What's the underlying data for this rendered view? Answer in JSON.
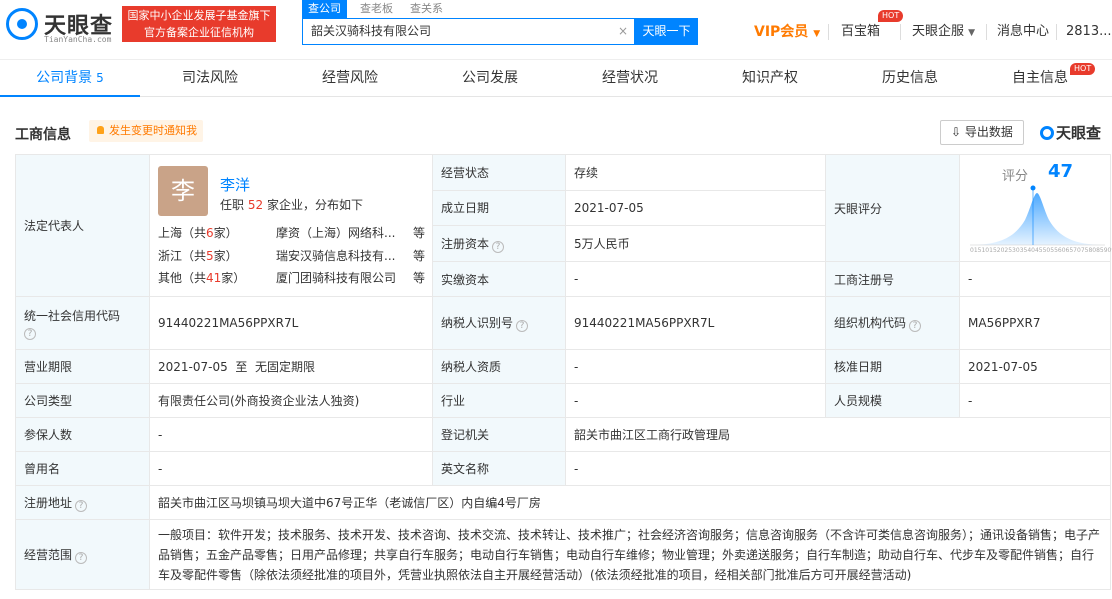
{
  "header": {
    "logo_name": "天眼查",
    "logo_sub": "TianYanCha.com",
    "fund_line1": "国家中小企业发展子基金旗下",
    "fund_line2": "官方备案企业征信机构",
    "search_tabs": [
      "查公司",
      "查老板",
      "查关系"
    ],
    "search_value": "韶关汉骑科技有限公司",
    "search_button": "天眼一下",
    "vip": "VIP会员",
    "baibaoxiang": "百宝箱",
    "hot": "HOT",
    "qiye": "天眼企服",
    "msg": "消息中心",
    "user": "2813..."
  },
  "tabs": [
    {
      "label": "公司背景",
      "count": "5"
    },
    {
      "label": "司法风险"
    },
    {
      "label": "经营风险"
    },
    {
      "label": "公司发展"
    },
    {
      "label": "经营状况"
    },
    {
      "label": "知识产权"
    },
    {
      "label": "历史信息"
    },
    {
      "label": "自主信息"
    }
  ],
  "section": {
    "title": "工商信息",
    "notify": "发生变更时通知我",
    "export": "导出数据",
    "brand": "天眼查"
  },
  "rep": {
    "label": "法定代表人",
    "avatar": "李",
    "name": "李洋",
    "sub_pre": "任职",
    "sub_num": "52",
    "sub_post": "家企业，分布如下",
    "rows": [
      {
        "region": "上海（共",
        "num": "6",
        "post": "家）",
        "company": "摩资（上海）网络科...",
        "more": "等"
      },
      {
        "region": "浙江（共",
        "num": "5",
        "post": "家）",
        "company": "瑞安汉骑信息科技有...",
        "more": "等"
      },
      {
        "region": "其他（共",
        "num": "41",
        "post": "家）",
        "company": "厦门团骑科技有限公司",
        "more": "等"
      }
    ]
  },
  "fields": {
    "status_l": "经营状态",
    "status_v": "存续",
    "found_l": "成立日期",
    "found_v": "2021-07-05",
    "capital_l": "注册资本",
    "capital_v": "5万人民币",
    "paid_l": "实缴资本",
    "paid_v": "-",
    "score_l": "天眼评分",
    "score_lab": "评分",
    "score_val": "47",
    "score_scale": [
      "0",
      "1",
      "5",
      "10",
      "15",
      "20",
      "25",
      "30",
      "35",
      "40",
      "45",
      "50",
      "55",
      "60",
      "65",
      "70",
      "75",
      "80",
      "85",
      "90",
      "95",
      "100"
    ],
    "reg_no_l": "工商注册号",
    "reg_no_v": "-",
    "credit_l": "统一社会信用代码",
    "credit_v": "91440221MA56PPXR7L",
    "tax_l": "纳税人识别号",
    "tax_v": "91440221MA56PPXR7L",
    "org_l": "组织机构代码",
    "org_v": "MA56PPXR7",
    "term_l": "营业期限",
    "term_v": "2021-07-05  至  无固定期限",
    "taxq_l": "纳税人资质",
    "taxq_v": "-",
    "approve_l": "核准日期",
    "approve_v": "2021-07-05",
    "type_l": "公司类型",
    "type_v": "有限责任公司(外商投资企业法人独资)",
    "industry_l": "行业",
    "industry_v": "-",
    "staff_l": "人员规模",
    "staff_v": "-",
    "insured_l": "参保人数",
    "insured_v": "-",
    "authority_l": "登记机关",
    "authority_v": "韶关市曲江区工商行政管理局",
    "former_l": "曾用名",
    "former_v": "-",
    "en_l": "英文名称",
    "en_v": "-",
    "addr_l": "注册地址",
    "addr_v": "韶关市曲江区马坝镇马坝大道中67号正华（老诚信厂区）内自编4号厂房",
    "scope_l": "经营范围",
    "scope_v": "一般项目：软件开发；技术服务、技术开发、技术咨询、技术交流、技术转让、技术推广；社会经济咨询服务；信息咨询服务（不含许可类信息咨询服务）；通讯设备销售；电子产品销售；五金产品零售；日用产品修理；共享自行车服务；电动自行车销售；电动自行车维修；物业管理；外卖递送服务；自行车制造；助动自行车、代步车及零配件销售；自行车及零配件零售（除依法须经批准的项目外，凭营业执照依法自主开展经营活动）(依法须经批准的项目，经相关部门批准后方可开展经营活动)"
  },
  "colors": {
    "accent": "#0084ff",
    "red": "#e83b2c",
    "orange": "#ff7a00",
    "label_bg": "#f2f9fc"
  }
}
